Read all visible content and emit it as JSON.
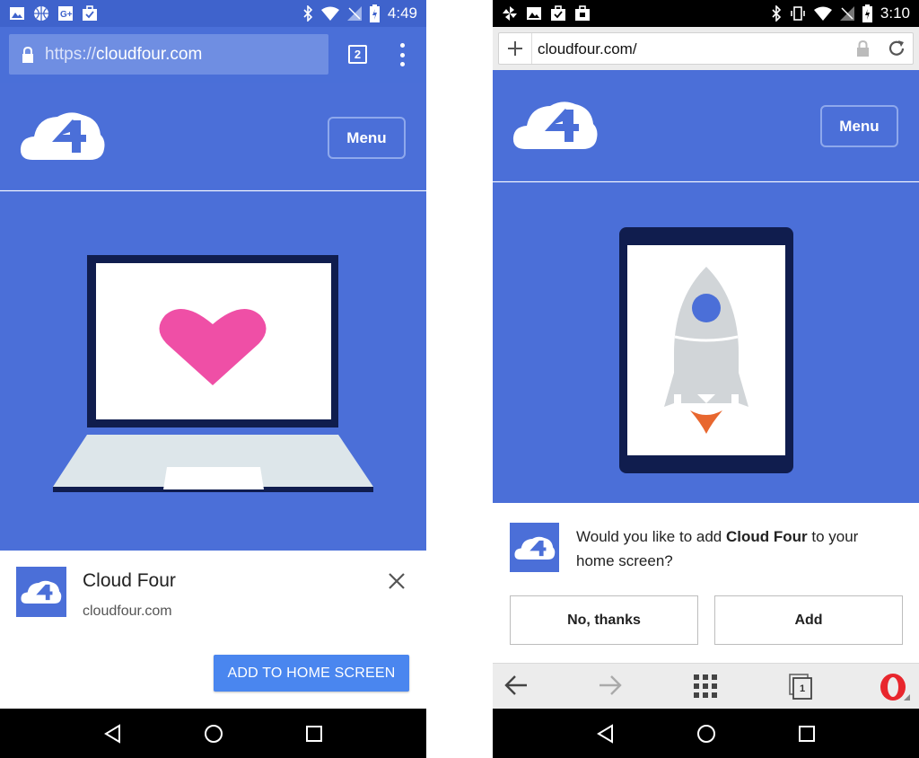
{
  "left_phone": {
    "status_bar": {
      "time": "4:49"
    },
    "address_bar": {
      "url_scheme": "https://",
      "url_host": "cloudfour.com",
      "tab_count": "2"
    },
    "site_header": {
      "menu_label": "Menu"
    },
    "install_banner": {
      "app_name": "Cloud Four",
      "app_url": "cloudfour.com",
      "add_button_label": "ADD TO HOME SCREEN"
    },
    "colors": {
      "brand_blue": "#4b6fd8",
      "heart_pink": "#ef4fa6",
      "button_blue": "#4a86ef"
    }
  },
  "right_phone": {
    "status_bar": {
      "time": "3:10"
    },
    "address_bar": {
      "url": "cloudfour.com/"
    },
    "site_header": {
      "menu_label": "Menu"
    },
    "install_prompt": {
      "text_before": "Would you like to add ",
      "app_name": "Cloud Four",
      "text_after": " to your home screen?",
      "decline_label": "No, thanks",
      "accept_label": "Add"
    },
    "toolbar": {
      "tab_count": "1"
    },
    "colors": {
      "brand_blue": "#4b6fd8",
      "opera_red": "#e8262d",
      "rocket_flame": "#e8672f"
    }
  }
}
